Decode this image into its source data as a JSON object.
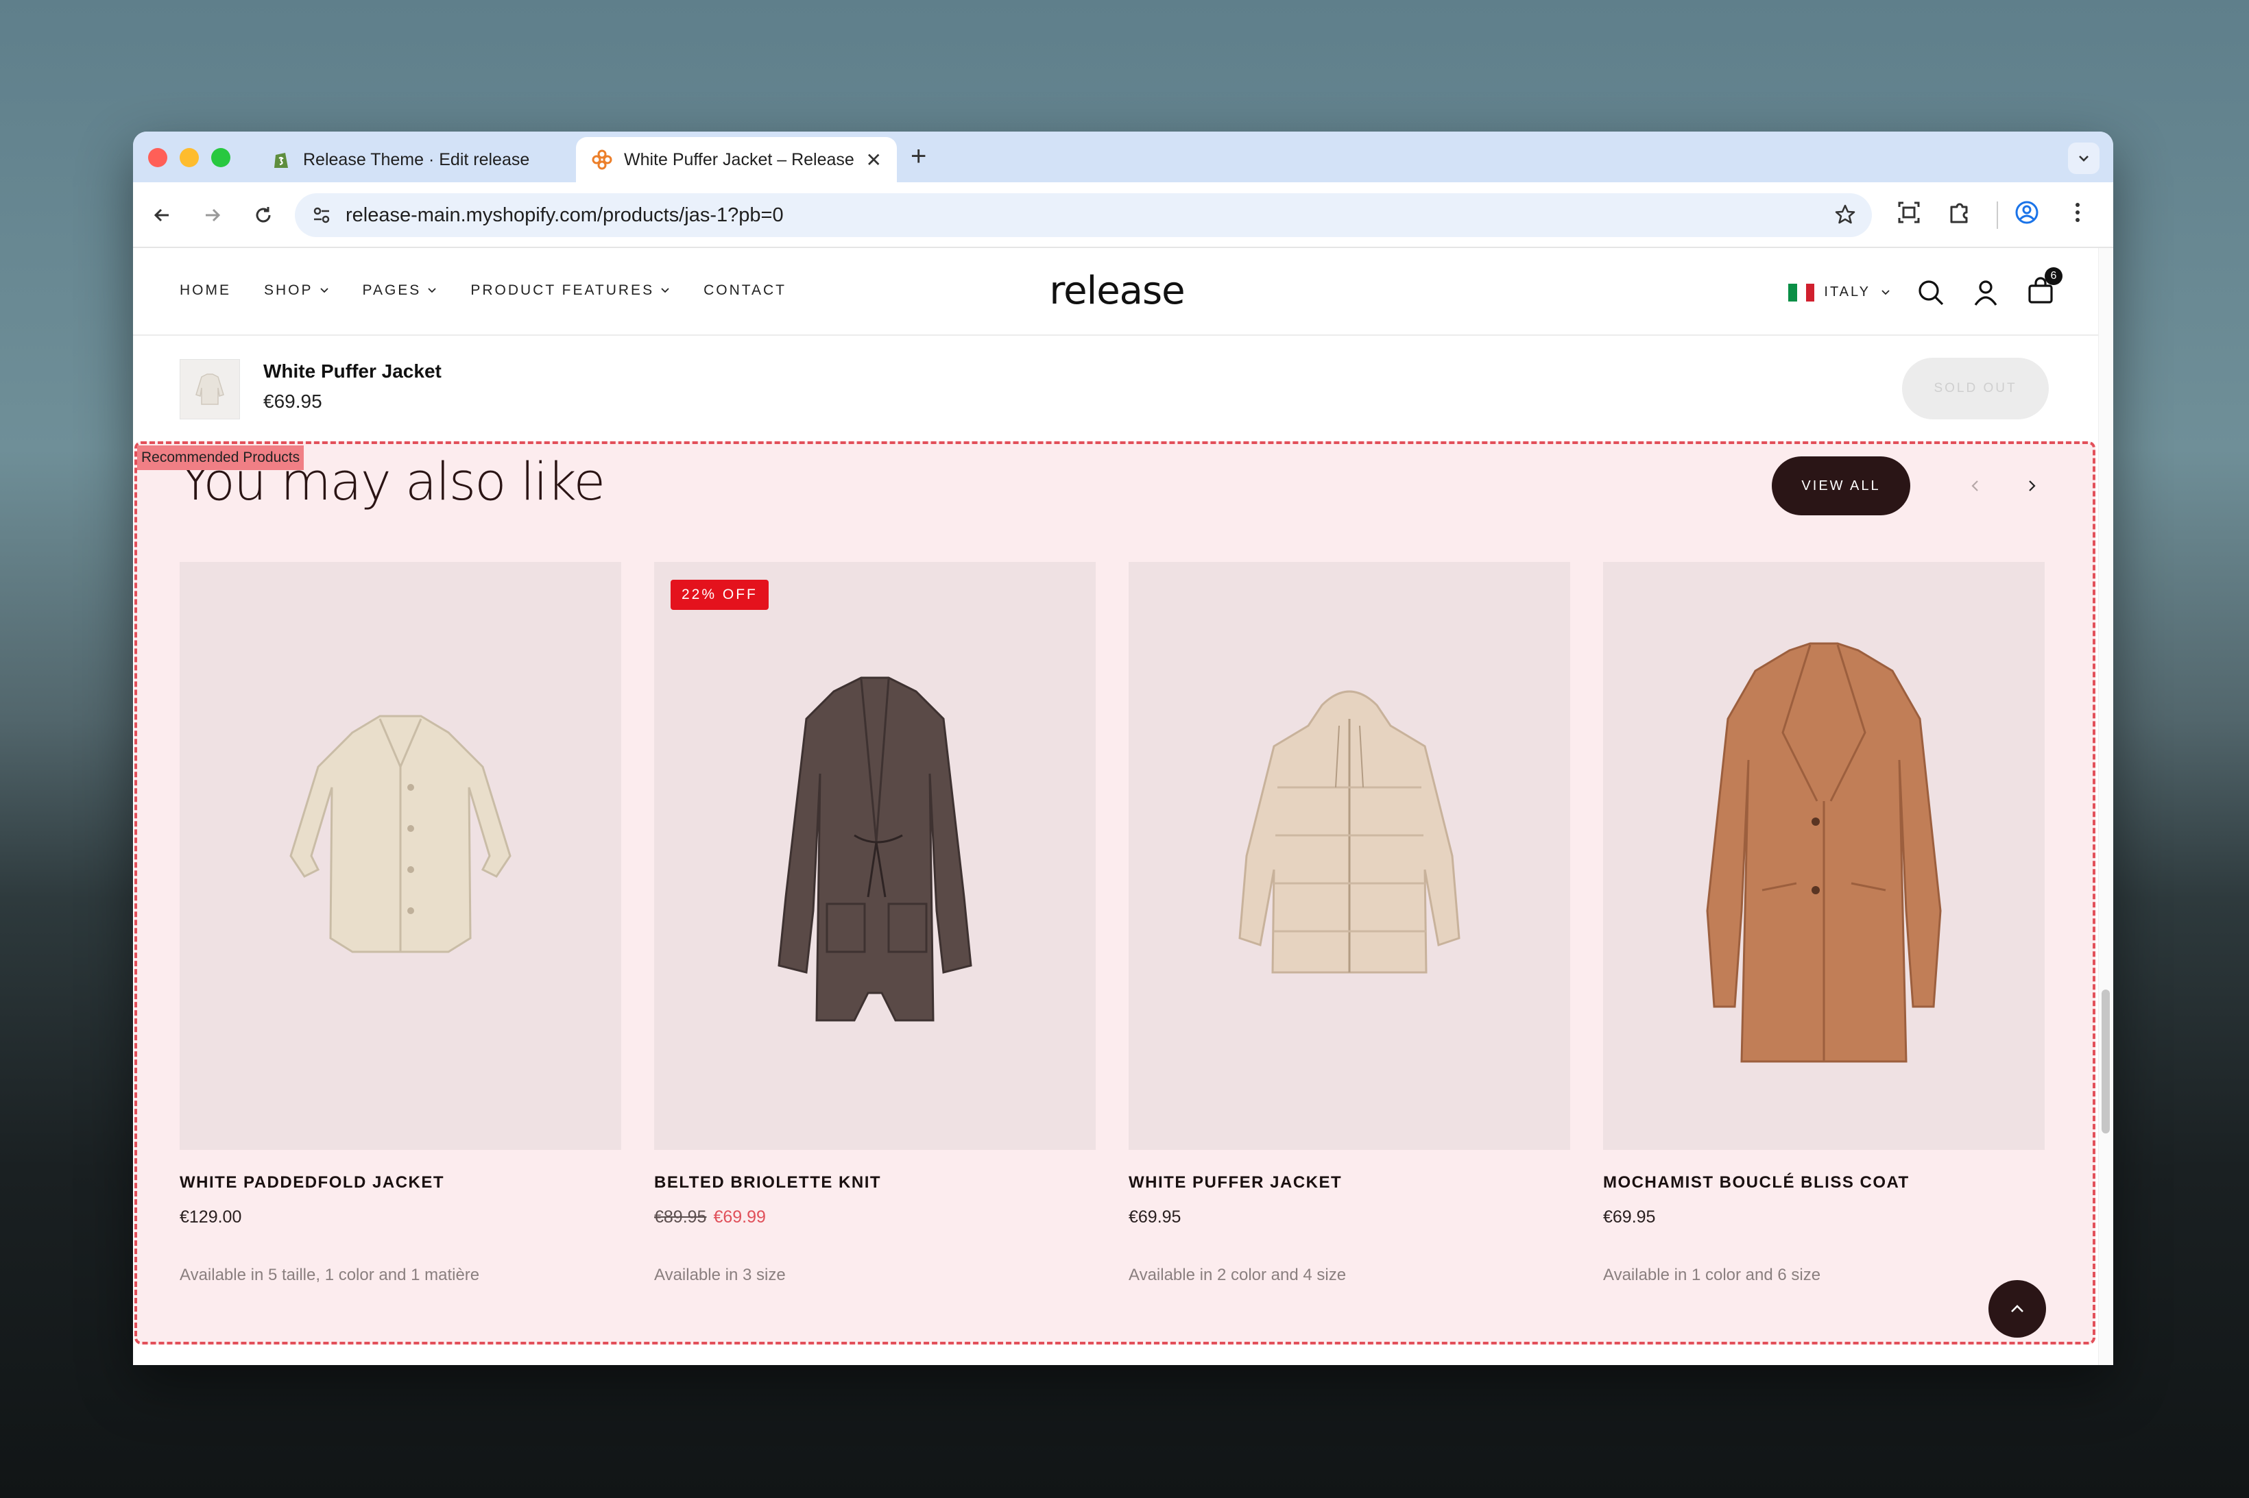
{
  "browser": {
    "tabs": [
      {
        "title": "Release Theme · Edit release",
        "close": "✕"
      },
      {
        "title": "White Puffer Jacket – Release",
        "close": "✕"
      }
    ],
    "new_tab": "+",
    "url": "release-main.myshopify.com/products/jas-1?pb=0"
  },
  "header": {
    "nav": [
      {
        "label": "HOME",
        "has_dropdown": false
      },
      {
        "label": "SHOP",
        "has_dropdown": true
      },
      {
        "label": "PAGES",
        "has_dropdown": true
      },
      {
        "label": "PRODUCT FEATURES",
        "has_dropdown": true
      },
      {
        "label": "CONTACT",
        "has_dropdown": false
      }
    ],
    "logo": "release",
    "locale": "ITALY",
    "cart_count": "6"
  },
  "sticky": {
    "title": "White Puffer Jacket",
    "price": "€69.95",
    "button": "SOLD OUT"
  },
  "reco": {
    "tag": "Recommended Products",
    "title": "You may also like",
    "view_all": "VIEW ALL",
    "products": [
      {
        "name": "WHITE PADDEDFOLD JACKET",
        "price": "€129.00",
        "old_price": "",
        "availability": "Available in 5 taille, 1 color and 1 matière",
        "badge": "",
        "garment": "jacket",
        "color": "#e9decb"
      },
      {
        "name": "BELTED BRIOLETTE KNIT",
        "price": "€69.99",
        "old_price": "€89.95",
        "availability": "Available in 3 size",
        "badge": "22% OFF",
        "garment": "cardigan",
        "color": "#5a4a47"
      },
      {
        "name": "WHITE PUFFER JACKET",
        "price": "€69.95",
        "old_price": "",
        "availability": "Available in 2 color and 4 size",
        "badge": "",
        "garment": "puffer",
        "color": "#e6d3c0"
      },
      {
        "name": "MOCHAMIST BOUCLÉ BLISS COAT",
        "price": "€69.95",
        "old_price": "",
        "availability": "Available in 1 color and 6 size",
        "badge": "",
        "garment": "coat",
        "color": "#c17e57"
      }
    ]
  },
  "colors": {
    "accent_dark": "#2a1516",
    "sale_red": "#e4121d",
    "reco_bg": "#fcecee",
    "reco_border": "#e2505a"
  }
}
